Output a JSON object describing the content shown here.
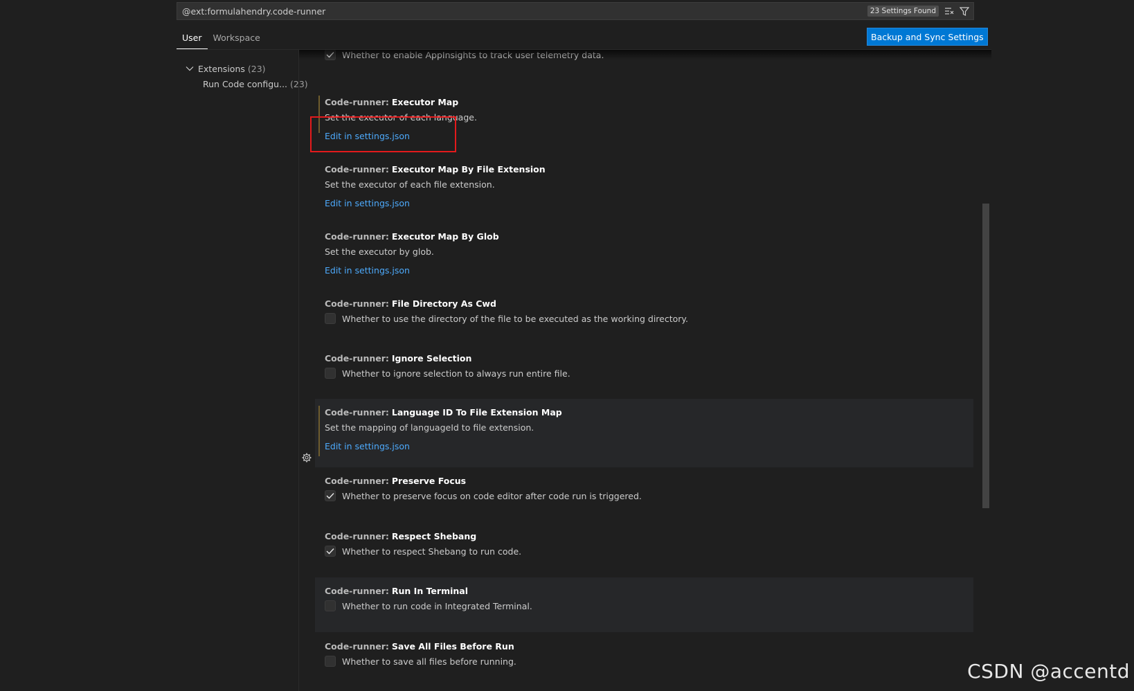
{
  "search": {
    "value": "@ext:formulahendry.code-runner",
    "results_badge": "23 Settings Found"
  },
  "tabs": [
    {
      "label": "User"
    },
    {
      "label": "Workspace"
    }
  ],
  "backup_button": "Backup and Sync Settings",
  "tree": [
    {
      "label": "Extensions",
      "count": "(23)"
    },
    {
      "label": "Run Code configu...",
      "count": "(23)"
    }
  ],
  "partial_top_text": "Whether to enable AppInsights to track user telemetry data.",
  "settings": [
    {
      "category": "Code-runner:",
      "name": "Executor Map",
      "description": "Set the executor of each language.",
      "link": "Edit in settings.json"
    },
    {
      "category": "Code-runner:",
      "name": "Executor Map By File Extension",
      "description": "Set the executor of each file extension.",
      "link": "Edit in settings.json"
    },
    {
      "category": "Code-runner:",
      "name": "Executor Map By Glob",
      "description": "Set the executor by glob.",
      "link": "Edit in settings.json"
    },
    {
      "category": "Code-runner:",
      "name": "File Directory As Cwd",
      "description": "Whether to use the directory of the file to be executed as the working directory.",
      "checked": false
    },
    {
      "category": "Code-runner:",
      "name": "Ignore Selection",
      "description": "Whether to ignore selection to always run entire file.",
      "checked": false
    },
    {
      "category": "Code-runner:",
      "name": "Language ID To File Extension Map",
      "description": "Set the mapping of languageId to file extension.",
      "link": "Edit in settings.json"
    },
    {
      "category": "Code-runner:",
      "name": "Preserve Focus",
      "description": "Whether to preserve focus on code editor after code run is triggered.",
      "checked": true
    },
    {
      "category": "Code-runner:",
      "name": "Respect Shebang",
      "description": "Whether to respect Shebang to run code.",
      "checked": true
    },
    {
      "category": "Code-runner:",
      "name": "Run In Terminal",
      "description": "Whether to run code in Integrated Terminal.",
      "checked": false
    },
    {
      "category": "Code-runner:",
      "name": "Save All Files Before Run",
      "description": "Whether to save all files before running.",
      "checked": false
    }
  ],
  "colors": {
    "accent": "#0078d4",
    "link": "#4daafc",
    "annotation": "#e41a1c",
    "modified": "#6f5d2e"
  },
  "watermark": "CSDN @accentd"
}
